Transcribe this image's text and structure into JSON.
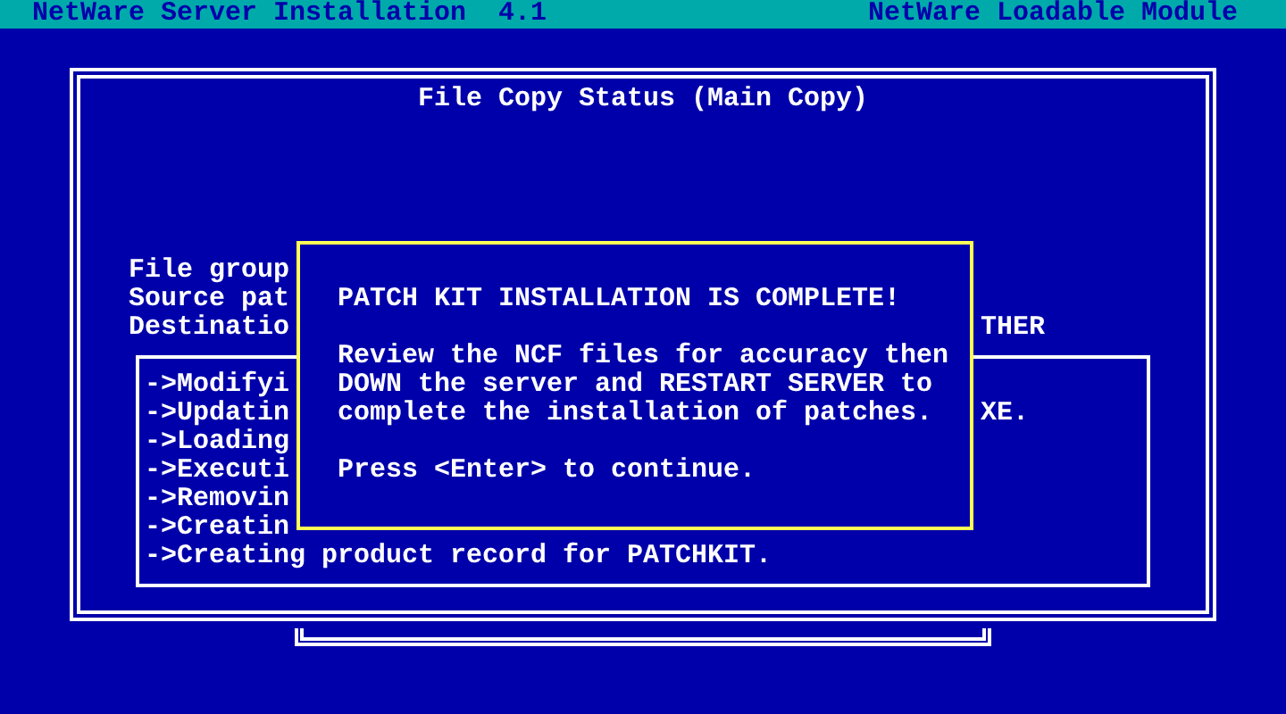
{
  "header": {
    "title": "NetWare Server Installation  4.1",
    "module": "NetWare Loadable Module"
  },
  "status_window": {
    "title": "File Copy Status (Main Copy)",
    "fields": [
      {
        "text": "File group"
      },
      {
        "text": "Source pat"
      },
      {
        "text": "Destinatio",
        "tail": "THER"
      }
    ],
    "log": [
      {
        "text": "->Modifyi"
      },
      {
        "text": "->Updatin",
        "tail": "XE."
      },
      {
        "text": "->Loading"
      },
      {
        "text": "->Executi"
      },
      {
        "text": "->Removin"
      },
      {
        "text": "->Creatin"
      },
      {
        "text": "->Creating product record for PATCHKIT."
      }
    ]
  },
  "dialog": {
    "title": "PATCH KIT INSTALLATION IS COMPLETE!",
    "message": [
      "Review the NCF files for accuracy then",
      "DOWN the server and RESTART SERVER to",
      "complete the installation of patches."
    ],
    "prompt": "Press <Enter> to continue."
  }
}
